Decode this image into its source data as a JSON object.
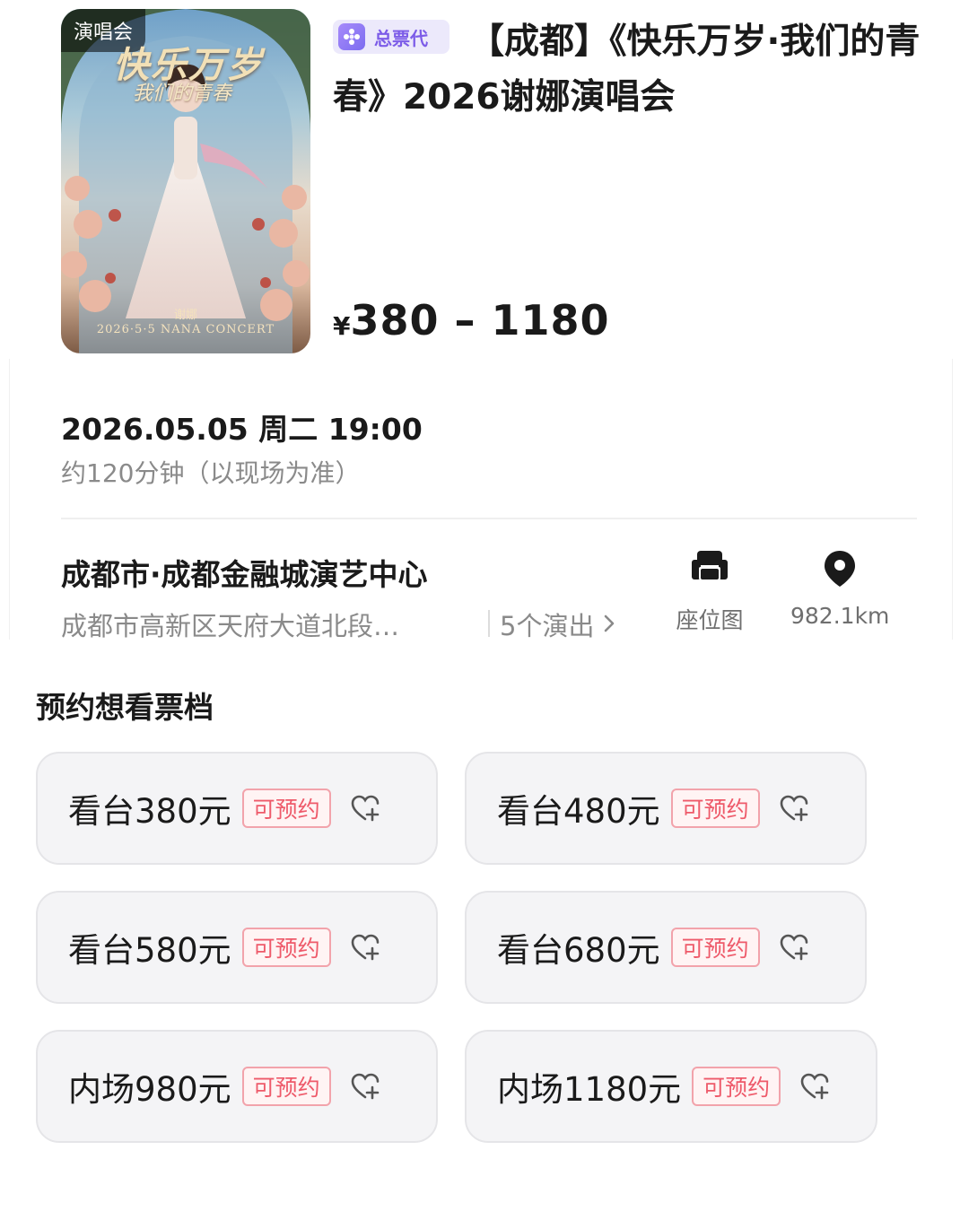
{
  "poster": {
    "tag": "演唱会",
    "title": "快乐万岁",
    "subtitle": "我们的青春",
    "artist": "谢娜",
    "concert_line": "2026·5·5 NANA CONCERT"
  },
  "event": {
    "agent_badge": "总票代",
    "title": "【成都】《快乐万岁·我们的青春》2026谢娜演唱会",
    "price_currency": "¥",
    "price_range": "380 – 1180"
  },
  "schedule": {
    "datetime": "2026.05.05 周二 19:00",
    "duration": "约120分钟（以现场为准）"
  },
  "venue": {
    "name": "成都市·成都金融城演艺中心",
    "address": "成都市高新区天府大道北段…",
    "shows": "5个演出",
    "seat_map_label": "座位图",
    "distance": "982.1km"
  },
  "tiers_section": {
    "title": "预约想看票档",
    "items": [
      {
        "label": "看台380元",
        "status": "可预约"
      },
      {
        "label": "看台480元",
        "status": "可预约"
      },
      {
        "label": "看台580元",
        "status": "可预约"
      },
      {
        "label": "看台680元",
        "status": "可预约"
      },
      {
        "label": "内场980元",
        "status": "可预约"
      },
      {
        "label": "内场1180元",
        "status": "可预约"
      }
    ]
  },
  "colors": {
    "accent_red": "#ee5a6a",
    "badge_purple": "#7c5ce8",
    "muted_text": "#8a8a8a"
  },
  "icons": [
    "sparkle-icon",
    "sofa-icon",
    "location-pin-icon",
    "chevron-right-icon",
    "heart-plus-icon"
  ]
}
